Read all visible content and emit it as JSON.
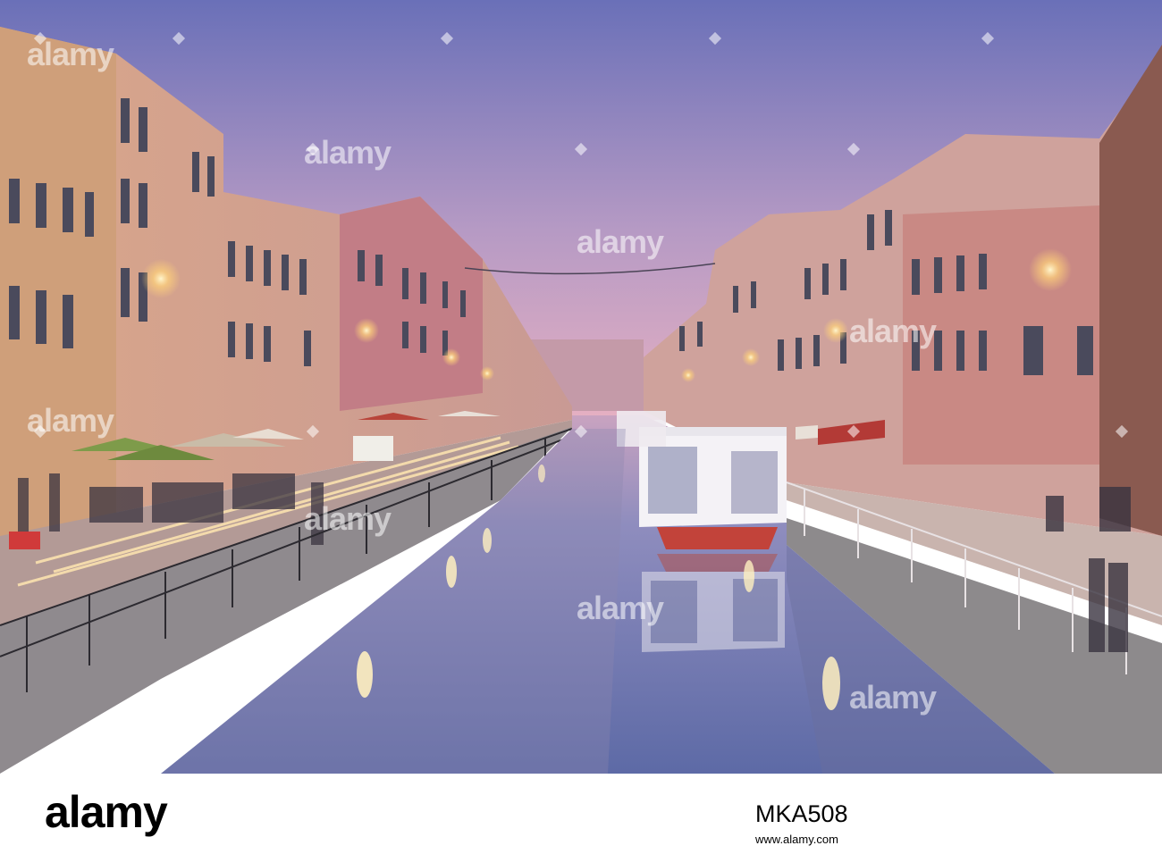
{
  "photo": {
    "subject": "canal at dusk with buildings on both banks",
    "colors": {
      "sky_top": "#6a70b8",
      "sky_bottom": "#e0aac0",
      "water": "#7a7fb2",
      "lights": "#ffd27a"
    }
  },
  "watermark": {
    "text": "alamy"
  },
  "footer": {
    "logo": "alamy",
    "image_id": "MKA508",
    "url": "www.alamy.com"
  }
}
